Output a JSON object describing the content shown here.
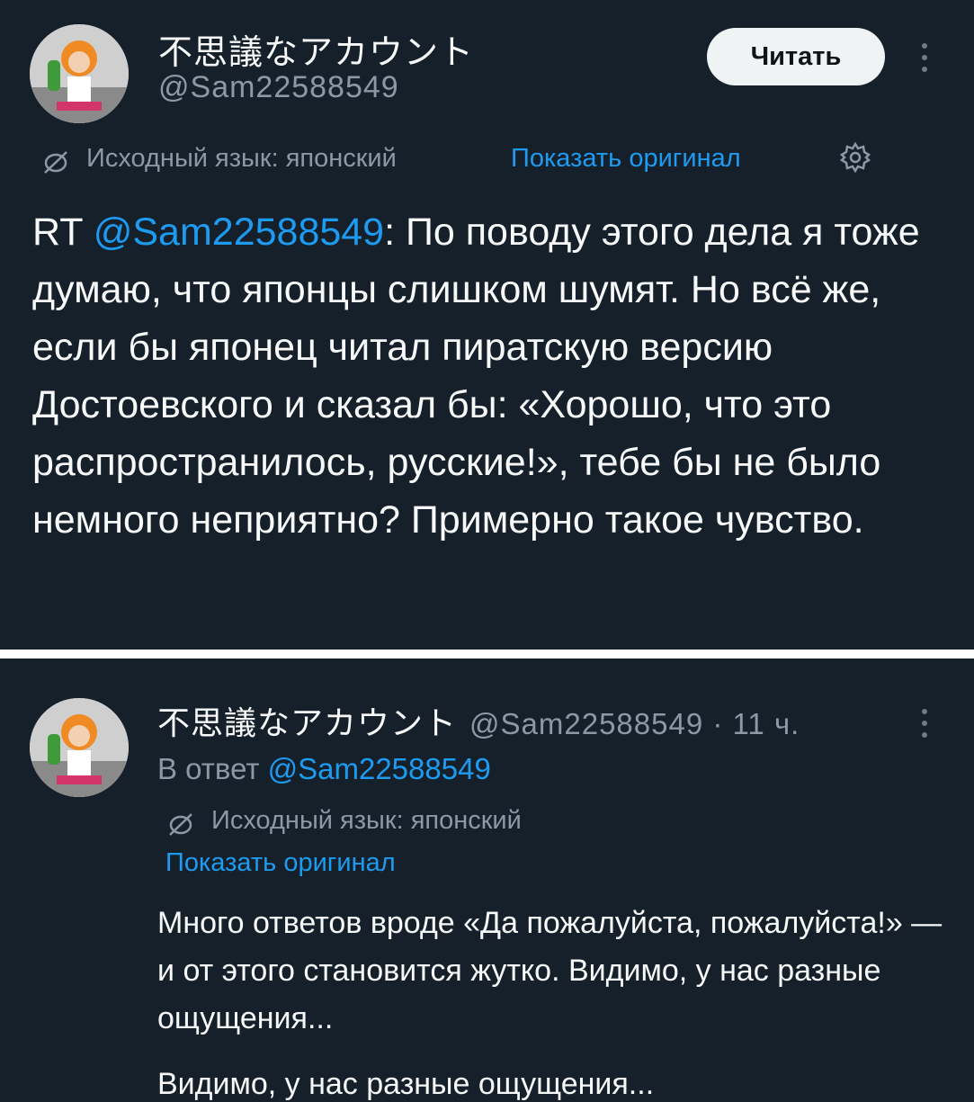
{
  "tweet": {
    "display_name": "不思議なアカウント",
    "handle": "@Sam22588549",
    "follow_label": "Читать",
    "source_lang": "Исходный язык: японский",
    "show_original": "Показать оригинал",
    "text_prefix": "RT ",
    "text_mention": "@Sam22588549",
    "text_body": ": По поводу этого дела я тоже думаю, что японцы слишком шумят. Но всё же, если бы японец читал пиратскую версию Достоевского и сказал бы: «Хорошо, что это распространилось, русские!», тебе бы не было немного неприятно? Примерно такое чувство."
  },
  "reply": {
    "display_name": "不思議なアカウント",
    "handle": "@Sam22588549",
    "separator": " · ",
    "time": "11 ч.",
    "reply_prefix": "В ответ ",
    "reply_mention": "@Sam22588549",
    "source_lang": "Исходный язык: японский",
    "show_original": "Показать оригинал",
    "text": "Много ответов вроде «Да пожалуйста, пожалуйста!» — и от этого становится жутко. Видимо, у нас разные ощущения...",
    "ghost_text": "Видимо, у нас разные ощущения..."
  },
  "colors": {
    "background": "#15202b",
    "text": "#f7f9f9",
    "secondary": "#8b98a5",
    "link": "#1d9bf0",
    "button_bg": "#eff3f4"
  },
  "icons": [
    "translate-icon",
    "gear-icon",
    "more-icon",
    "avatar"
  ]
}
